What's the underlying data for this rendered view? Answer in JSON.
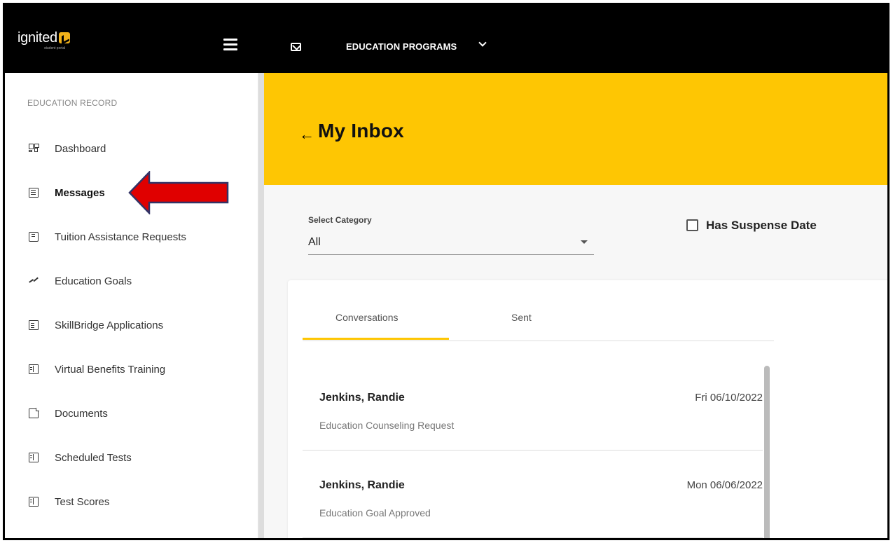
{
  "app": {
    "brand": "ignited",
    "brand_sub": "student portal",
    "programs_label": "EDUCATION PROGRAMS"
  },
  "sidebar": {
    "section_title": "EDUCATION RECORD",
    "items": [
      {
        "label": "Dashboard",
        "icon": "dashboard-icon"
      },
      {
        "label": "Messages",
        "icon": "message-icon",
        "active": true
      },
      {
        "label": "Tuition Assistance Requests",
        "icon": "tuition-icon"
      },
      {
        "label": "Education Goals",
        "icon": "trending-icon"
      },
      {
        "label": "SkillBridge Applications",
        "icon": "clipboard-icon"
      },
      {
        "label": "Virtual Benefits Training",
        "icon": "book-icon"
      },
      {
        "label": "Documents",
        "icon": "document-icon"
      },
      {
        "label": "Scheduled Tests",
        "icon": "book-icon"
      },
      {
        "label": "Test Scores",
        "icon": "book-icon"
      }
    ]
  },
  "main": {
    "title": "My Inbox",
    "filter": {
      "category_label": "Select Category",
      "category_value": "All",
      "suspense_label": "Has Suspense Date",
      "suspense_checked": false
    },
    "tabs": [
      {
        "label": "Conversations",
        "active": true
      },
      {
        "label": "Sent",
        "active": false
      }
    ],
    "messages": [
      {
        "from": "Jenkins, Randie",
        "date": "Fri 06/10/2022",
        "subject": "Education Counseling Request"
      },
      {
        "from": "Jenkins, Randie",
        "date": "Mon 06/06/2022",
        "subject": "Education Goal Approved"
      }
    ]
  },
  "colors": {
    "topbar": "#000000",
    "banner": "#fec603",
    "annotation_arrow": "#e00000"
  }
}
